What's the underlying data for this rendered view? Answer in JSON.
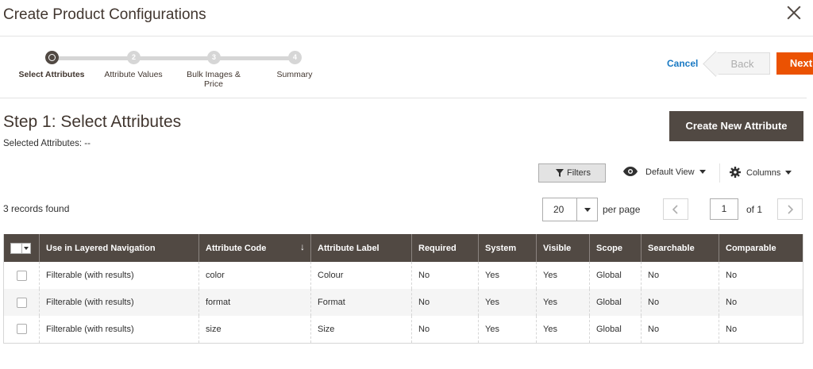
{
  "modal": {
    "title": "Create Product Configurations"
  },
  "steps": [
    {
      "number": "1",
      "label": "Select Attributes",
      "active": true
    },
    {
      "number": "2",
      "label": "Attribute Values",
      "active": false
    },
    {
      "number": "3",
      "label": "Bulk Images & Price",
      "active": false
    },
    {
      "number": "4",
      "label": "Summary",
      "active": false
    }
  ],
  "nav": {
    "cancel": "Cancel",
    "back": "Back",
    "next": "Next"
  },
  "step_header": {
    "title": "Step 1: Select Attributes",
    "selected": "Selected Attributes: --",
    "create_button": "Create New Attribute"
  },
  "toolbar": {
    "filters": "Filters",
    "view": "Default View",
    "columns": "Columns",
    "records": "3 records found",
    "per_page_value": "20",
    "per_page_label": "per page",
    "page": "1",
    "of": "of 1"
  },
  "grid": {
    "columns": [
      "Use in Layered Navigation",
      "Attribute Code",
      "Attribute Label",
      "Required",
      "System",
      "Visible",
      "Scope",
      "Searchable",
      "Comparable"
    ],
    "rows": [
      [
        "Filterable (with results)",
        "color",
        "Colour",
        "No",
        "Yes",
        "Yes",
        "Global",
        "No",
        "No"
      ],
      [
        "Filterable (with results)",
        "format",
        "Format",
        "No",
        "Yes",
        "Yes",
        "Global",
        "No",
        "No"
      ],
      [
        "Filterable (with results)",
        "size",
        "Size",
        "No",
        "Yes",
        "Yes",
        "Global",
        "No",
        "No"
      ]
    ]
  },
  "colors": {
    "accent": "#eb5202",
    "header": "#514943",
    "link": "#1979c3"
  }
}
